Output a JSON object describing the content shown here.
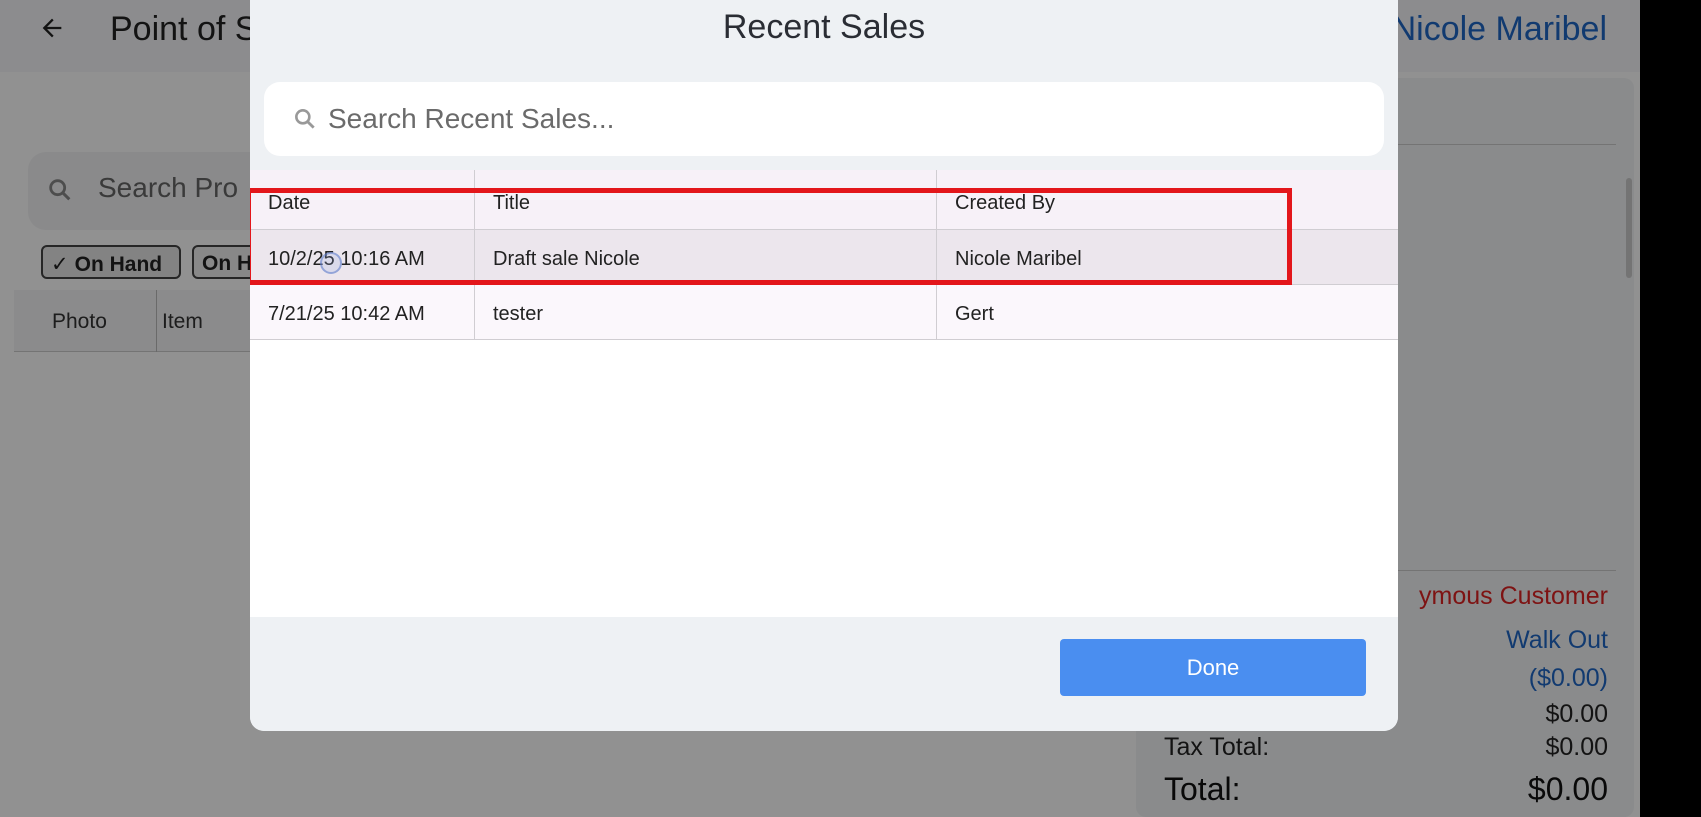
{
  "app": {
    "title": "Point of S",
    "user": "Nicole Maribel",
    "product_search_placeholder": "Search Pro",
    "chips": [
      "On Hand",
      "On H"
    ],
    "product_columns": [
      "Photo",
      "Item"
    ]
  },
  "cart": {
    "customer": "ymous Customer",
    "walk_out": "Walk Out",
    "discount": "($0.00)",
    "subtotal_value": "$0.00",
    "tax_label": "Tax Total:",
    "tax_value": "$0.00",
    "total_label": "Total:",
    "total_value": "$0.00"
  },
  "dialog": {
    "title": "Recent Sales",
    "search_placeholder": "Search Recent Sales...",
    "columns": [
      "Date",
      "Title",
      "Created By"
    ],
    "rows": [
      {
        "date": "10/2/25 10:16 AM",
        "title": "Draft sale Nicole",
        "created_by": "Nicole Maribel"
      },
      {
        "date": "7/21/25 10:42 AM",
        "title": "tester",
        "created_by": "Gert"
      }
    ],
    "done_label": "Done"
  },
  "colors": {
    "accent": "#4a8ef0",
    "highlight": "#e3161b",
    "link": "#1f66c5",
    "alert": "#d22222"
  }
}
